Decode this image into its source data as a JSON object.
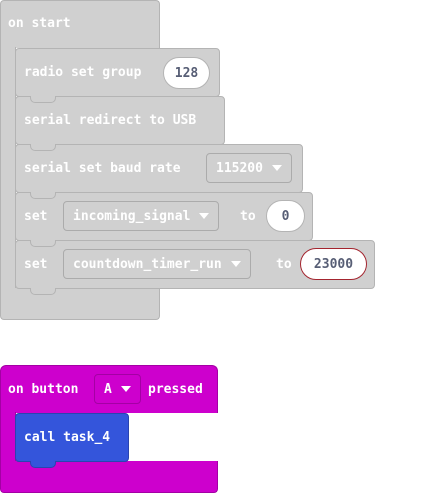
{
  "on_start": {
    "header_label": "on start",
    "blocks": {
      "radio_set_group": {
        "label": "radio set group",
        "value": "128"
      },
      "serial_redirect": {
        "label": "serial redirect to USB"
      },
      "serial_baud": {
        "label": "serial set baud rate",
        "dropdown": "115200"
      },
      "set_incoming": {
        "set_label": "set",
        "variable": "incoming_signal",
        "to_label": "to",
        "value": "0"
      },
      "set_countdown": {
        "set_label": "set",
        "variable": "countdown_timer_run",
        "to_label": "to",
        "value": "23000"
      }
    },
    "colors": {
      "block": "#d0d0d0",
      "border": "#b4b4b4"
    }
  },
  "on_button": {
    "prefix_label": "on button",
    "button_dropdown": "A",
    "suffix_label": "pressed",
    "call": {
      "label": "call task_4"
    },
    "colors": {
      "block": "#cd00cd",
      "call_block": "#3455db"
    }
  }
}
